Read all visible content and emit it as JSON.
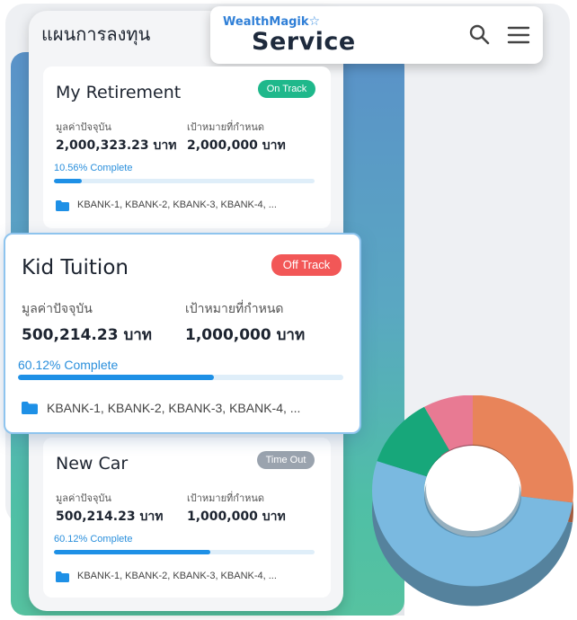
{
  "app": {
    "title": "แผนการลงทุน",
    "logo_top": "WealthMagik",
    "logo_bottom": "Service"
  },
  "colors": {
    "on_track": "#1fb88b",
    "off_track": "#f25757",
    "time_out": "#9aa3ae",
    "progress": "#1e90e6"
  },
  "labels": {
    "current_value": "มูลค่าปัจจุบัน",
    "target": "เป้าหมายที่กำหนด"
  },
  "plans": [
    {
      "name": "My Retirement",
      "status": "On Track",
      "current_value": "2,000,323.23 บาท",
      "target_value": "2,000,000 บาท",
      "complete_text": "10.56% Complete",
      "progress": 0.1056,
      "accounts": "KBANK-1, KBANK-2, KBANK-3, KBANK-4, ..."
    },
    {
      "name": "Kid Tuition",
      "status": "Off Track",
      "current_value": "500,214.23 บาท",
      "target_value": "1,000,000 บาท",
      "complete_text": "60.12% Complete",
      "progress": 0.6012,
      "accounts": "KBANK-1, KBANK-2, KBANK-3, KBANK-4, ..."
    },
    {
      "name": "New Car",
      "status": "Time Out",
      "current_value": "500,214.23 บาท",
      "target_value": "1,000,000 บาท",
      "complete_text": "60.12% Complete",
      "progress": 0.6012,
      "accounts": "KBANK-1, KBANK-2, KBANK-3, KBANK-4, ..."
    }
  ],
  "icons": {
    "search": "search-icon",
    "menu": "hamburger-menu-icon",
    "folder": "folder-icon"
  },
  "donut": {
    "segments": [
      {
        "color": "#e8845a",
        "fraction": 0.27
      },
      {
        "color": "#7ab9e0",
        "fraction": 0.53
      },
      {
        "color": "#17a77a",
        "fraction": 0.12
      },
      {
        "color": "#e87a93",
        "fraction": 0.08
      }
    ]
  }
}
